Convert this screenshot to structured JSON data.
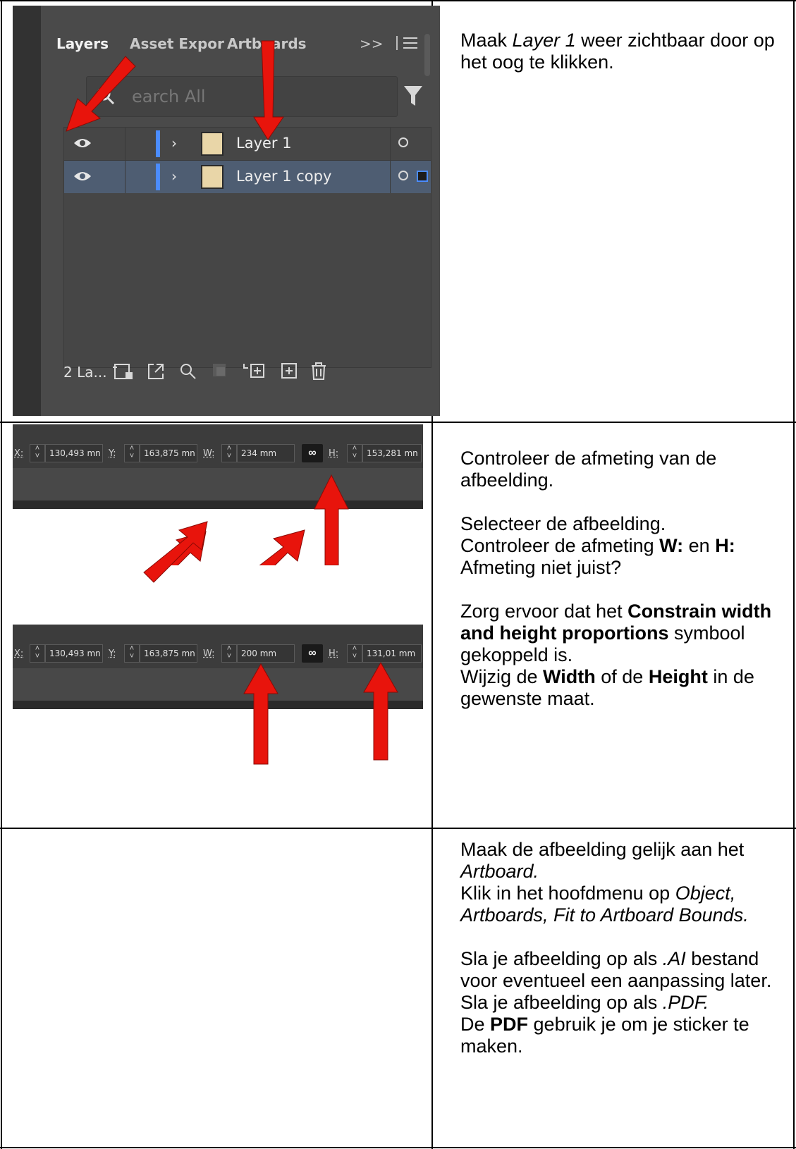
{
  "layers_panel": {
    "tabs": [
      "Layers",
      "Asset Expor",
      "Artboards"
    ],
    "overflow_label": ">>",
    "search_placeholder": "earch All",
    "layers": [
      {
        "name": "Layer 1"
      },
      {
        "name": "Layer 1 copy"
      }
    ],
    "layer_count": "2 La..."
  },
  "properties_before": {
    "x_label": "X:",
    "x_value": "130,493 mn",
    "y_label": "Y:",
    "y_value": "163,875 mn",
    "w_label": "W:",
    "w_value": "234 mm",
    "h_label": "H:",
    "h_value": "153,281 mn"
  },
  "properties_after": {
    "x_label": "X:",
    "x_value": "130,493 mn",
    "y_label": "Y:",
    "y_value": "163,875 mn",
    "w_label": "W:",
    "w_value": "200 mm",
    "h_label": "H:",
    "h_value": "131,01 mm"
  },
  "instructions": {
    "row1": {
      "p1_a": "Maak ",
      "p1_b": "Layer 1",
      "p1_c": " weer zichtbaar door op het oog te klikken."
    },
    "row2": {
      "p1": "Controleer de afmeting van de afbeelding.",
      "p2": "Selecteer de afbeelding.",
      "p3_a": "Controleer de afmeting ",
      "p3_b": "W:",
      "p3_c": " en ",
      "p3_d": "H:",
      "p4": "Afmeting niet juist?",
      "p5_a": "Zorg ervoor dat het ",
      "p5_b": "Constrain width and height proportions",
      "p5_c": " symbool gekoppeld is.",
      "p6_a": "Wijzig de ",
      "p6_b": "Width",
      "p6_c": " of de ",
      "p6_d": "Height",
      "p6_e": " in de gewenste maat."
    },
    "row3": {
      "p1_a": "Maak de afbeelding gelijk aan het ",
      "p1_b": "Artboard.",
      "p2_a": "Klik in het hoofdmenu op ",
      "p2_b": "Object, Artboards, Fit to Artboard Bounds.",
      "p3_a": "Sla je afbeelding op als ",
      "p3_b": ".AI",
      "p3_c": " bestand voor eventueel een aanpassing later.",
      "p4_a": "Sla je afbeelding op als ",
      "p4_b": ".PDF.",
      "p5_a": "De ",
      "p5_b": "PDF",
      "p5_c": " gebruik je om je sticker te maken."
    }
  },
  "colors": {
    "arrow": "#e8140c",
    "layer_color": "#4b8cff",
    "selected_row": "#4e5d72"
  },
  "icons": [
    "search-icon",
    "filter-icon",
    "eye-icon",
    "chevron-right-icon",
    "menu-icon",
    "artboard-icon",
    "export-icon",
    "locate-icon",
    "mask-icon",
    "sublayer-icon",
    "new-layer-icon",
    "trash-icon",
    "link-icon"
  ]
}
